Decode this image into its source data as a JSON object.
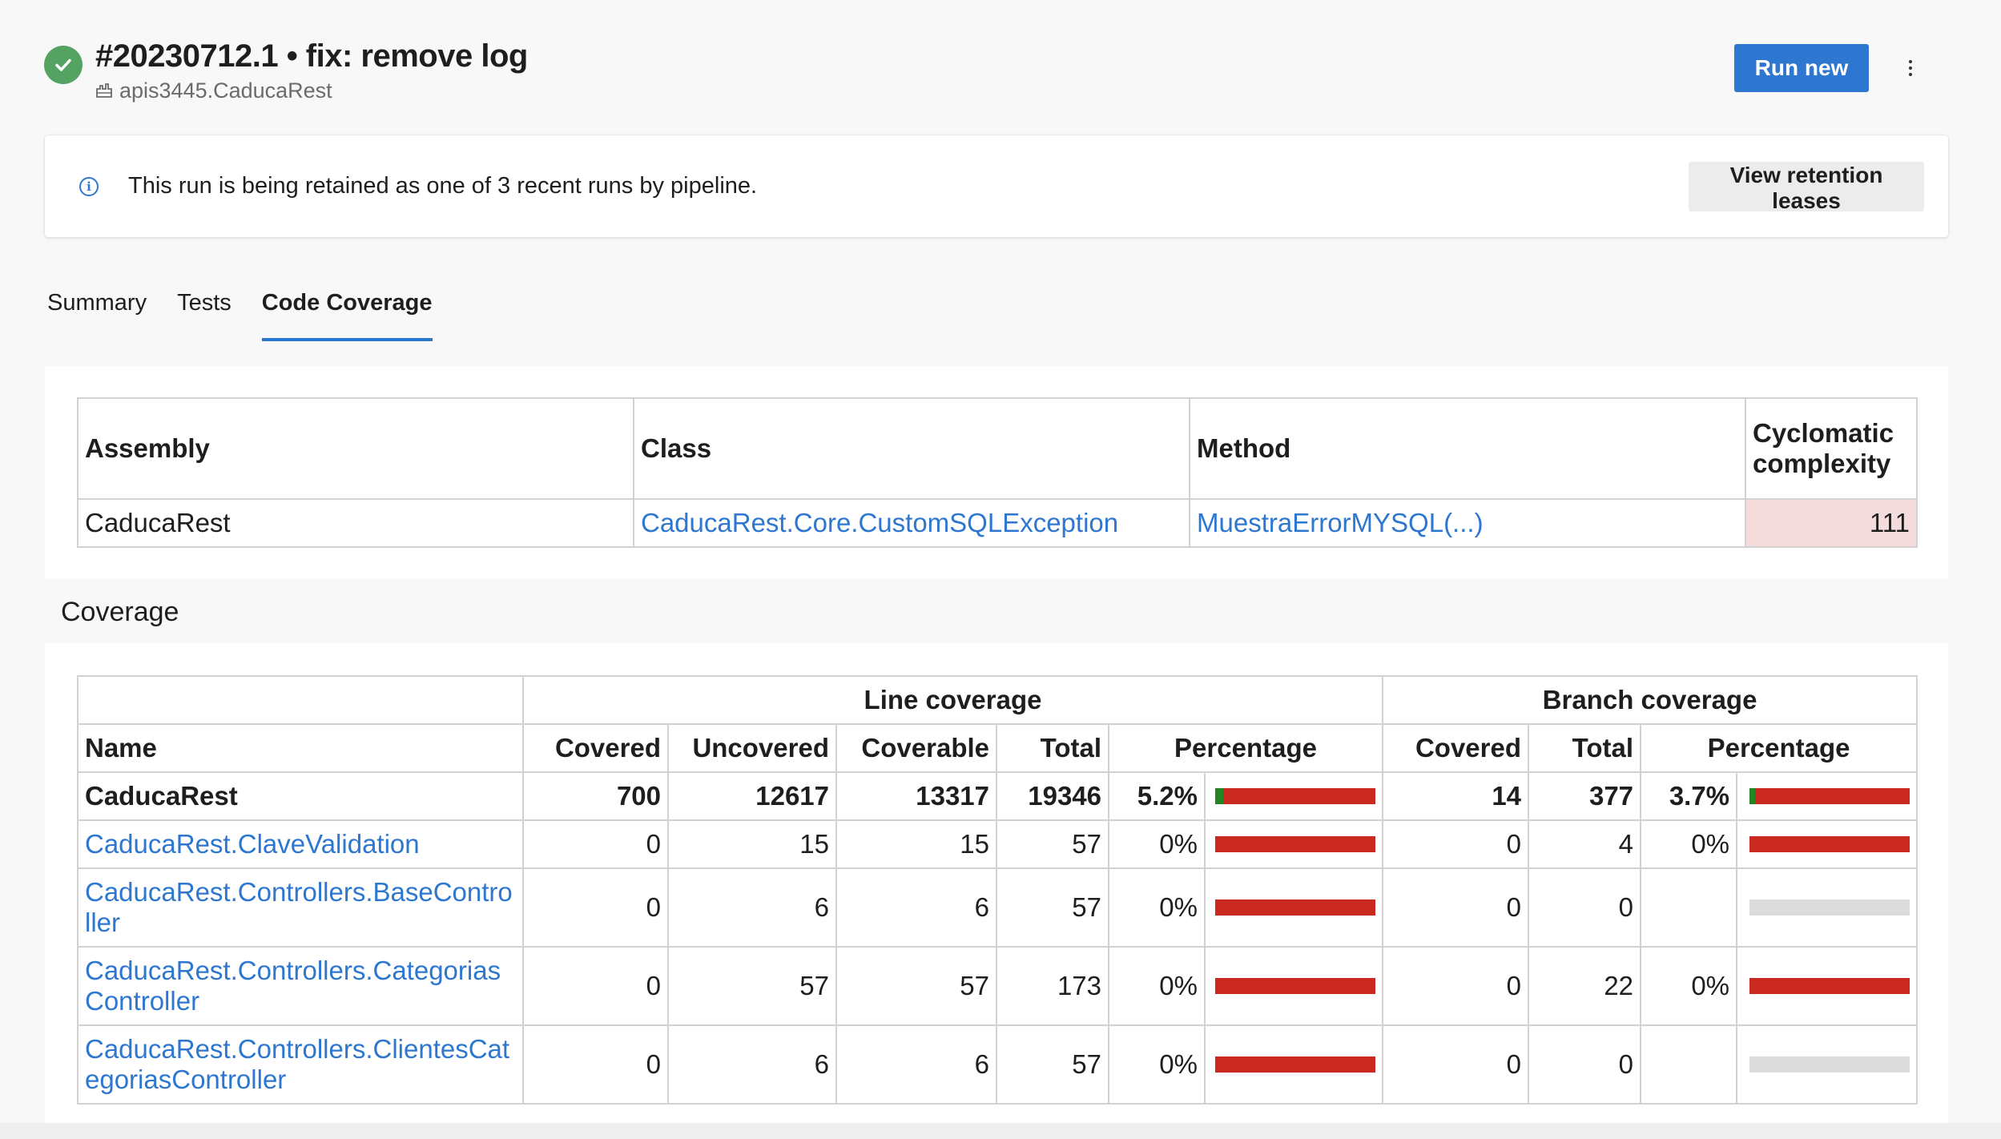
{
  "header": {
    "title": "#20230712.1 • fix: remove log",
    "repo": "apis3445.CaducaRest",
    "run_new_label": "Run new",
    "status_icon": "check-circle-icon",
    "repo_icon": "repo-icon"
  },
  "banner": {
    "text": "This run is being retained as one of 3 recent runs by pipeline.",
    "button_label": "View retention leases"
  },
  "tabs": [
    {
      "label": "Summary"
    },
    {
      "label": "Tests"
    },
    {
      "label": "Code Coverage"
    }
  ],
  "risk_table": {
    "headers": {
      "assembly": "Assembly",
      "class": "Class",
      "method": "Method",
      "complexity": "Cyclomatic complexity"
    },
    "row": {
      "assembly": "CaducaRest",
      "class": "CaducaRest.Core.CustomSQLException",
      "method": "MuestraErrorMYSQL(...)",
      "complexity": "111"
    }
  },
  "coverage": {
    "section_title": "Coverage",
    "group_headers": {
      "line": "Line coverage",
      "branch": "Branch coverage"
    },
    "columns": {
      "name": "Name",
      "covered": "Covered",
      "uncovered": "Uncovered",
      "coverable": "Coverable",
      "total": "Total",
      "percentage": "Percentage",
      "b_covered": "Covered",
      "b_total": "Total",
      "b_percentage": "Percentage"
    },
    "rows": [
      {
        "name": "CaducaRest",
        "covered": "700",
        "uncovered": "12617",
        "coverable": "13317",
        "total": "19346",
        "line_pct": "5.2%",
        "line_fraction": 0.052,
        "b_covered": "14",
        "b_total": "377",
        "b_pct": "3.7%",
        "branch_fraction": 0.037
      },
      {
        "name": "CaducaRest.ClaveValidation",
        "covered": "0",
        "uncovered": "15",
        "coverable": "15",
        "total": "57",
        "line_pct": "0%",
        "line_fraction": 0,
        "b_covered": "0",
        "b_total": "4",
        "b_pct": "0%",
        "branch_fraction": 0
      },
      {
        "name": "CaducaRest.Controllers.BaseController",
        "covered": "0",
        "uncovered": "6",
        "coverable": "6",
        "total": "57",
        "line_pct": "0%",
        "line_fraction": 0,
        "b_covered": "0",
        "b_total": "0",
        "b_pct": "",
        "branch_fraction": null
      },
      {
        "name": "CaducaRest.Controllers.CategoriasController",
        "covered": "0",
        "uncovered": "57",
        "coverable": "57",
        "total": "173",
        "line_pct": "0%",
        "line_fraction": 0,
        "b_covered": "0",
        "b_total": "22",
        "b_pct": "0%",
        "branch_fraction": 0
      },
      {
        "name": "CaducaRest.Controllers.ClientesCategoriasController",
        "covered": "0",
        "uncovered": "6",
        "coverable": "6",
        "total": "57",
        "line_pct": "0%",
        "line_fraction": 0,
        "b_covered": "0",
        "b_total": "0",
        "b_pct": "",
        "branch_fraction": null
      }
    ]
  },
  "colors": {
    "accent": "#2e77d0",
    "success": "#55a362",
    "bar_covered": "#218621",
    "bar_uncovered": "#c9291f"
  }
}
